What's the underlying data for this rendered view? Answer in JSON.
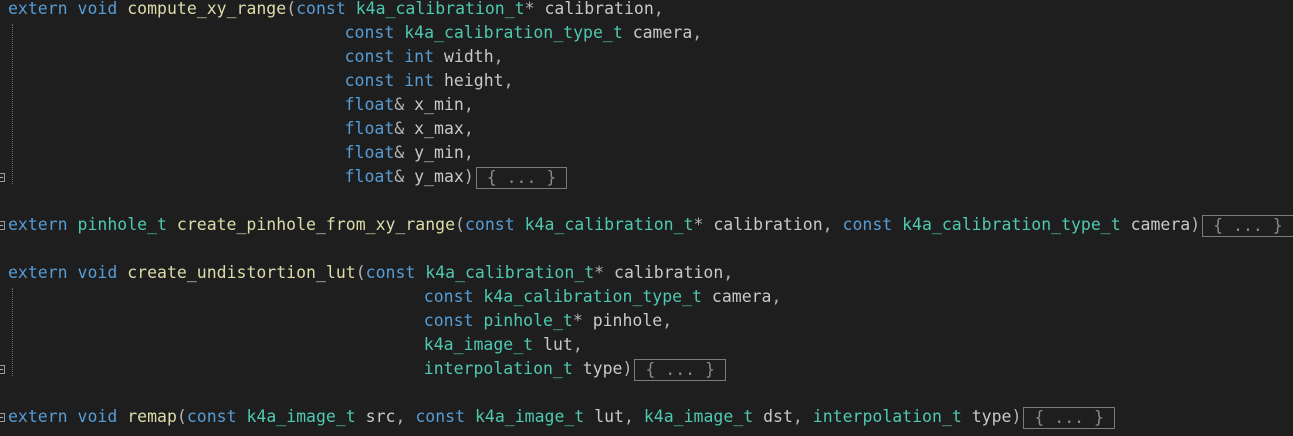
{
  "colors": {
    "background": "#1e1e1e",
    "keyword": "#569cd6",
    "type": "#4ec9b0",
    "function": "#dcdcaa",
    "identifier": "#c8c8c8",
    "punctuation": "#b4b4b4",
    "collapsed_box": "#7a7a7a"
  },
  "collapsed_label": "{ ... }",
  "lines": [
    {
      "indent": 0,
      "tokens": [
        [
          "kw",
          "extern"
        ],
        [
          "pu",
          " "
        ],
        [
          "kw",
          "void"
        ],
        [
          "pu",
          " "
        ],
        [
          "fn",
          "compute_xy_range"
        ],
        [
          "pu",
          "("
        ],
        [
          "kw",
          "const"
        ],
        [
          "pu",
          " "
        ],
        [
          "ty",
          "k4a_calibration_t"
        ],
        [
          "pu",
          "* "
        ],
        [
          "id",
          "calibration"
        ],
        [
          "pu",
          ","
        ]
      ]
    },
    {
      "indent": 34,
      "tokens": [
        [
          "kw",
          "const"
        ],
        [
          "pu",
          " "
        ],
        [
          "ty",
          "k4a_calibration_type_t"
        ],
        [
          "pu",
          " "
        ],
        [
          "id",
          "camera"
        ],
        [
          "pu",
          ","
        ]
      ]
    },
    {
      "indent": 34,
      "tokens": [
        [
          "kw",
          "const"
        ],
        [
          "pu",
          " "
        ],
        [
          "kw",
          "int"
        ],
        [
          "pu",
          " "
        ],
        [
          "id",
          "width"
        ],
        [
          "pu",
          ","
        ]
      ]
    },
    {
      "indent": 34,
      "tokens": [
        [
          "kw",
          "const"
        ],
        [
          "pu",
          " "
        ],
        [
          "kw",
          "int"
        ],
        [
          "pu",
          " "
        ],
        [
          "id",
          "height"
        ],
        [
          "pu",
          ","
        ]
      ]
    },
    {
      "indent": 34,
      "tokens": [
        [
          "kw",
          "float"
        ],
        [
          "pu",
          "& "
        ],
        [
          "id",
          "x_min"
        ],
        [
          "pu",
          ","
        ]
      ]
    },
    {
      "indent": 34,
      "tokens": [
        [
          "kw",
          "float"
        ],
        [
          "pu",
          "& "
        ],
        [
          "id",
          "x_max"
        ],
        [
          "pu",
          ","
        ]
      ]
    },
    {
      "indent": 34,
      "tokens": [
        [
          "kw",
          "float"
        ],
        [
          "pu",
          "& "
        ],
        [
          "id",
          "y_min"
        ],
        [
          "pu",
          ","
        ]
      ]
    },
    {
      "indent": 34,
      "tokens": [
        [
          "kw",
          "float"
        ],
        [
          "pu",
          "& "
        ],
        [
          "id",
          "y_max"
        ],
        [
          "pu",
          ")"
        ]
      ],
      "collapsed": true
    },
    {
      "indent": 0,
      "tokens": []
    },
    {
      "indent": 0,
      "tokens": [
        [
          "kw",
          "extern"
        ],
        [
          "pu",
          " "
        ],
        [
          "ty",
          "pinhole_t"
        ],
        [
          "pu",
          " "
        ],
        [
          "fn",
          "create_pinhole_from_xy_range"
        ],
        [
          "pu",
          "("
        ],
        [
          "kw",
          "const"
        ],
        [
          "pu",
          " "
        ],
        [
          "ty",
          "k4a_calibration_t"
        ],
        [
          "pu",
          "* "
        ],
        [
          "id",
          "calibration"
        ],
        [
          "pu",
          ", "
        ],
        [
          "kw",
          "const"
        ],
        [
          "pu",
          " "
        ],
        [
          "ty",
          "k4a_calibration_type_t"
        ],
        [
          "pu",
          " "
        ],
        [
          "id",
          "camera"
        ],
        [
          "pu",
          ")"
        ]
      ],
      "collapsed": true
    },
    {
      "indent": 0,
      "tokens": []
    },
    {
      "indent": 0,
      "tokens": [
        [
          "kw",
          "extern"
        ],
        [
          "pu",
          " "
        ],
        [
          "kw",
          "void"
        ],
        [
          "pu",
          " "
        ],
        [
          "fn",
          "create_undistortion_lut"
        ],
        [
          "pu",
          "("
        ],
        [
          "kw",
          "const"
        ],
        [
          "pu",
          " "
        ],
        [
          "ty",
          "k4a_calibration_t"
        ],
        [
          "pu",
          "* "
        ],
        [
          "id",
          "calibration"
        ],
        [
          "pu",
          ","
        ]
      ]
    },
    {
      "indent": 42,
      "tokens": [
        [
          "kw",
          "const"
        ],
        [
          "pu",
          " "
        ],
        [
          "ty",
          "k4a_calibration_type_t"
        ],
        [
          "pu",
          " "
        ],
        [
          "id",
          "camera"
        ],
        [
          "pu",
          ","
        ]
      ]
    },
    {
      "indent": 42,
      "tokens": [
        [
          "kw",
          "const"
        ],
        [
          "pu",
          " "
        ],
        [
          "ty",
          "pinhole_t"
        ],
        [
          "pu",
          "* "
        ],
        [
          "id",
          "pinhole"
        ],
        [
          "pu",
          ","
        ]
      ]
    },
    {
      "indent": 42,
      "tokens": [
        [
          "ty",
          "k4a_image_t"
        ],
        [
          "pu",
          " "
        ],
        [
          "id",
          "lut"
        ],
        [
          "pu",
          ","
        ]
      ]
    },
    {
      "indent": 42,
      "tokens": [
        [
          "ty",
          "interpolation_t"
        ],
        [
          "pu",
          " "
        ],
        [
          "id",
          "type"
        ],
        [
          "pu",
          ")"
        ]
      ],
      "collapsed": true
    },
    {
      "indent": 0,
      "tokens": []
    },
    {
      "indent": 0,
      "tokens": [
        [
          "kw",
          "extern"
        ],
        [
          "pu",
          " "
        ],
        [
          "kw",
          "void"
        ],
        [
          "pu",
          " "
        ],
        [
          "fn",
          "remap"
        ],
        [
          "pu",
          "("
        ],
        [
          "kw",
          "const"
        ],
        [
          "pu",
          " "
        ],
        [
          "ty",
          "k4a_image_t"
        ],
        [
          "pu",
          " "
        ],
        [
          "id",
          "src"
        ],
        [
          "pu",
          ", "
        ],
        [
          "kw",
          "const"
        ],
        [
          "pu",
          " "
        ],
        [
          "ty",
          "k4a_image_t"
        ],
        [
          "pu",
          " "
        ],
        [
          "id",
          "lut"
        ],
        [
          "pu",
          ", "
        ],
        [
          "ty",
          "k4a_image_t"
        ],
        [
          "pu",
          " "
        ],
        [
          "id",
          "dst"
        ],
        [
          "pu",
          ", "
        ],
        [
          "ty",
          "interpolation_t"
        ],
        [
          "pu",
          " "
        ],
        [
          "id",
          "type"
        ],
        [
          "pu",
          ")"
        ]
      ],
      "collapsed": true
    }
  ]
}
